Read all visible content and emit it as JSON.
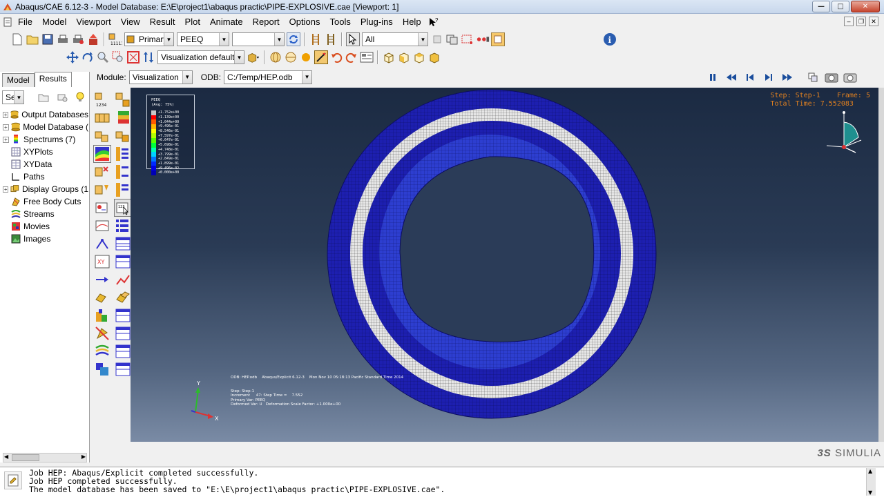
{
  "window": {
    "title": "Abaqus/CAE 6.12-3 - Model Database: E:\\E\\project1\\abaqus practic\\PIPE-EXPLOSIVE.cae [Viewport: 1]"
  },
  "menu": {
    "items": [
      "File",
      "Model",
      "Viewport",
      "View",
      "Result",
      "Plot",
      "Animate",
      "Report",
      "Options",
      "Tools",
      "Plug-ins",
      "Help"
    ]
  },
  "toolbar1": {
    "variable_position": "Primary",
    "variable_name": "PEEQ",
    "component": "",
    "selection_filter": "All"
  },
  "toolbar2": {
    "render_style": "Visualization defaults"
  },
  "module_bar": {
    "module_label": "Module:",
    "module_value": "Visualization",
    "odb_label": "ODB:",
    "odb_value": "C:/Temp/HEP.odb"
  },
  "left_panel": {
    "tabs": [
      "Model",
      "Results"
    ],
    "active_tab": "Results",
    "session_combo": "Session",
    "tree": [
      {
        "label": "Output Databases",
        "expandable": true
      },
      {
        "label": "Model Database (",
        "expandable": true
      },
      {
        "label": "Spectrums (7)",
        "expandable": true
      },
      {
        "label": "XYPlots",
        "expandable": false
      },
      {
        "label": "XYData",
        "expandable": false
      },
      {
        "label": "Paths",
        "expandable": false
      },
      {
        "label": "Display Groups (1",
        "expandable": true
      },
      {
        "label": "Free Body Cuts",
        "expandable": false
      },
      {
        "label": "Streams",
        "expandable": false
      },
      {
        "label": "Movies",
        "expandable": false
      },
      {
        "label": "Images",
        "expandable": false
      }
    ]
  },
  "viewport": {
    "step_line": "Step: Step-1    Frame: 5",
    "time_line": "Total Time: 7.552083",
    "legend_title": "PEEQ",
    "legend_subtitle": "(Avg: 75%)",
    "legend_values": [
      "+1.752e+00",
      "+1.139e+00",
      "+1.044e+00",
      "+9.496e-01",
      "+8.546e-01",
      "+7.597e-01",
      "+6.647e-01",
      "+5.698e-01",
      "+4.748e-01",
      "+3.799e-01",
      "+2.849e-01",
      "+1.899e-01",
      "+9.496e-02",
      "+0.000e+00"
    ],
    "legend_colors": [
      "#c8c8c8",
      "#ff0000",
      "#ff5a00",
      "#ffb400",
      "#ffff00",
      "#b4ff00",
      "#5aff00",
      "#00ff3c",
      "#00ffb4",
      "#00d2ff",
      "#0078ff",
      "#0028ff",
      "#0000e6",
      "#0000b4"
    ],
    "odb_line": "ODB: HEP.odb    Abaqus/Explicit 6.12-3    Mon Nov 10 05:18:13 Pacific Standard Time 2014",
    "info_lines": [
      "Step: Step-1",
      "Increment     47: Step Time =    7.552",
      "Primary Var: PEEQ",
      "Deformed Var: U   Deformation Scale Factor: +1.000e+00"
    ],
    "triad_x": "X",
    "triad_y": "Y"
  },
  "branding": {
    "logo_text": "SIMULIA"
  },
  "messages": [
    "Job HEP: Abaqus/Explicit completed successfully.",
    "Job HEP completed successfully.",
    "The model database has been saved to \"E:\\E\\project1\\abaqus practic\\PIPE-EXPLOSIVE.cae\"."
  ],
  "colors": {
    "mesh_dark_blue": "#1d1fb0",
    "mesh_band": "#d8d8d8",
    "step_text": "#e08020"
  }
}
